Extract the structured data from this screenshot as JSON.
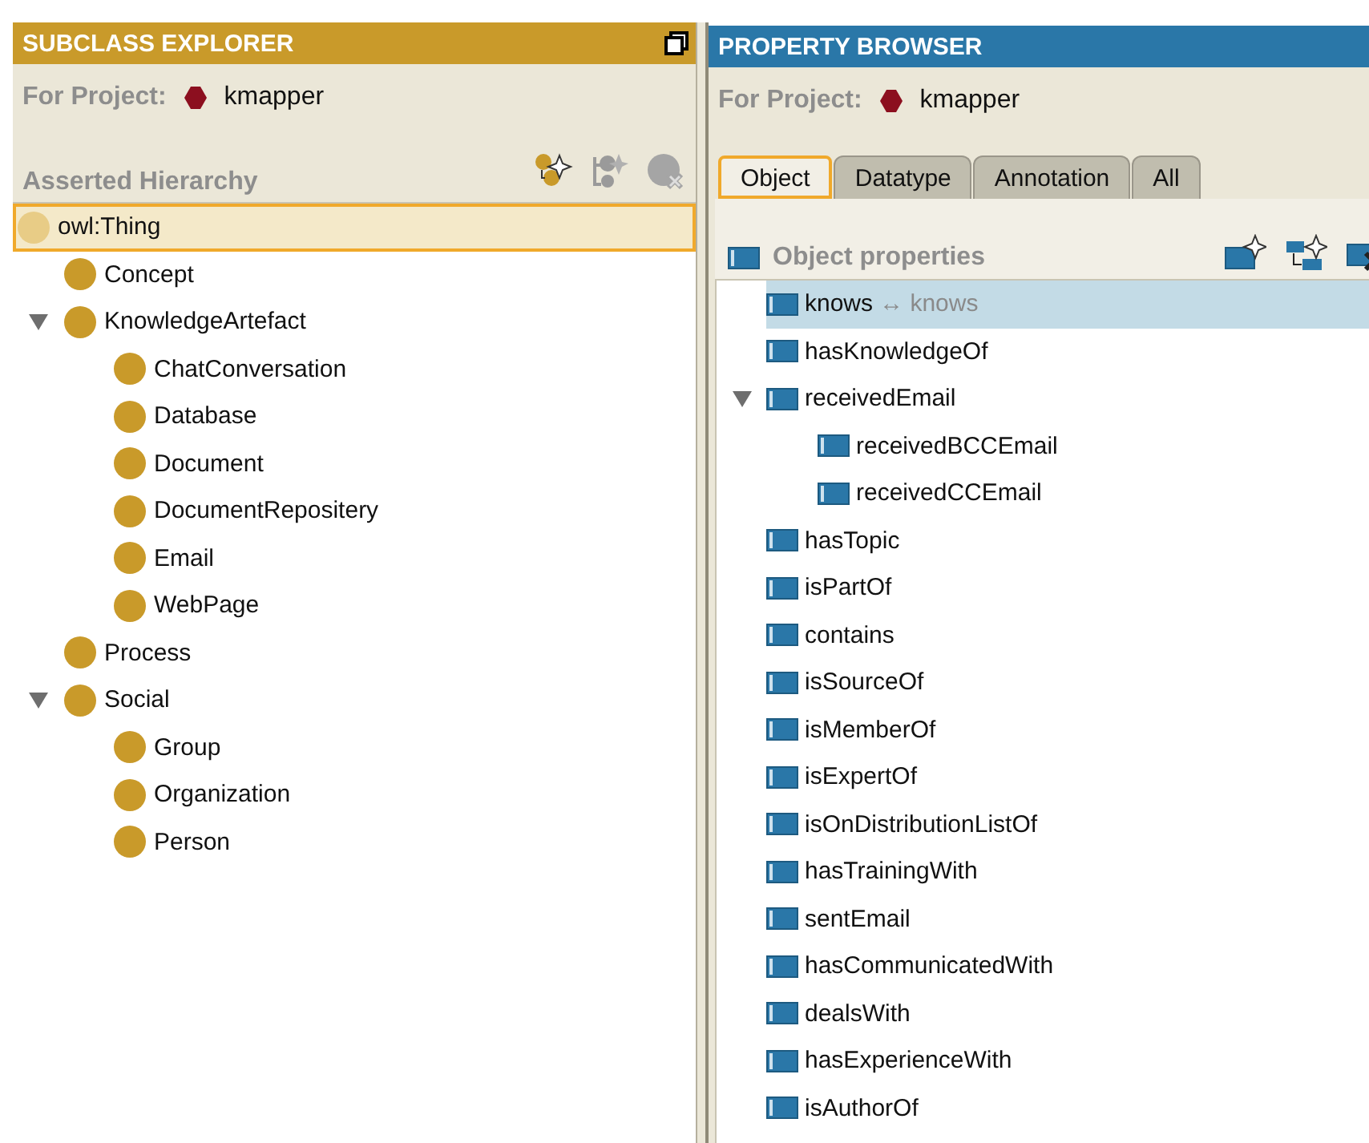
{
  "subclass_explorer": {
    "title": "SUBCLASS EXPLORER",
    "project_label": "For Project:",
    "project_name": "kmapper",
    "hierarchy_label": "Asserted Hierarchy",
    "tree": [
      {
        "label": "owl:Thing",
        "selected": true,
        "children": [
          {
            "label": "Concept",
            "selected": false
          },
          {
            "label": "KnowledgeArtefact",
            "selected": false,
            "expanded": true,
            "children": [
              {
                "label": "ChatConversation",
                "selected": false
              },
              {
                "label": "Database",
                "selected": false
              },
              {
                "label": "Document",
                "selected": false
              },
              {
                "label": "DocumentRepositery",
                "selected": false
              },
              {
                "label": "Email",
                "selected": false
              },
              {
                "label": "WebPage",
                "selected": false
              }
            ]
          },
          {
            "label": "Process",
            "selected": false
          },
          {
            "label": "Social",
            "selected": false,
            "expanded": true,
            "children": [
              {
                "label": "Group",
                "selected": false
              },
              {
                "label": "Organization",
                "selected": false
              },
              {
                "label": "Person",
                "selected": false
              }
            ]
          }
        ]
      }
    ]
  },
  "property_browser": {
    "title": "PROPERTY BROWSER",
    "project_label": "For Project:",
    "project_name": "kmapper",
    "tabs": [
      {
        "label": "Object",
        "selected": true
      },
      {
        "label": "Datatype",
        "selected": false
      },
      {
        "label": "Annotation",
        "selected": false
      },
      {
        "label": "All",
        "selected": false
      }
    ],
    "section_label": "Object properties",
    "properties": [
      {
        "label": "knows",
        "inverse": "↔ knows",
        "selected": true
      },
      {
        "label": "hasKnowledgeOf",
        "selected": false
      },
      {
        "label": "receivedEmail",
        "selected": false,
        "expanded": true,
        "children": [
          {
            "label": "receivedBCCEmail",
            "selected": false
          },
          {
            "label": "receivedCCEmail",
            "selected": false
          }
        ]
      },
      {
        "label": "hasTopic",
        "selected": false
      },
      {
        "label": "isPartOf",
        "selected": false
      },
      {
        "label": "contains",
        "selected": false
      },
      {
        "label": "isSourceOf",
        "selected": false
      },
      {
        "label": "isMemberOf",
        "selected": false
      },
      {
        "label": "isExpertOf",
        "selected": false
      },
      {
        "label": "isOnDistributionListOf",
        "selected": false
      },
      {
        "label": "hasTrainingWith",
        "selected": false
      },
      {
        "label": "sentEmail",
        "selected": false
      },
      {
        "label": "hasCommunicatedWith",
        "selected": false
      },
      {
        "label": "dealsWith",
        "selected": false
      },
      {
        "label": "hasExperienceWith",
        "selected": false
      },
      {
        "label": "isAuthorOf",
        "selected": false
      }
    ]
  }
}
